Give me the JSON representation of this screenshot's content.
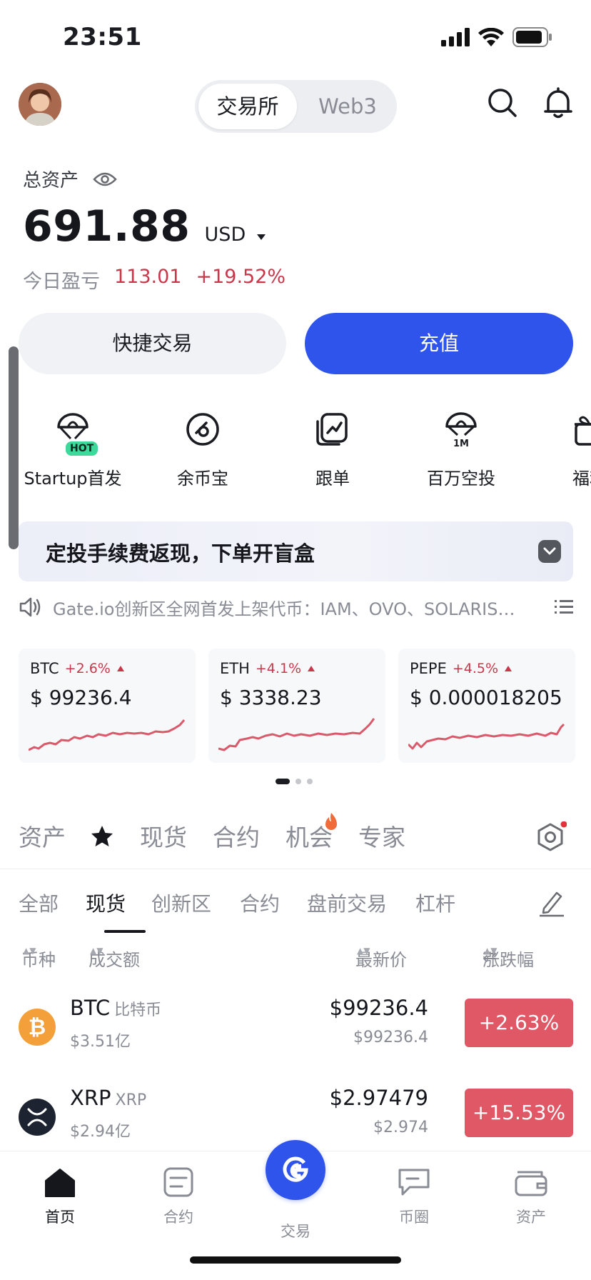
{
  "status": {
    "time": "23:51"
  },
  "top": {
    "segments": [
      "交易所",
      "Web3"
    ]
  },
  "assets": {
    "label": "总资产",
    "value": "691.88",
    "unit": "USD",
    "pnl_label": "今日盈亏",
    "pnl_value": "113.01",
    "pnl_pct": "+19.52%"
  },
  "buttons": {
    "quick": "快捷交易",
    "deposit": "充值"
  },
  "features": [
    "Startup首发",
    "余币宝",
    "跟单",
    "百万空投",
    "福利"
  ],
  "feature_badges": {
    "hot": "HOT",
    "onem": "1M"
  },
  "banner": {
    "text": "定投手续费返现，下单开盲盒"
  },
  "notice": {
    "text": "Gate.io创新区全网首发上架代币：IAM、OVO、SOLARIS…"
  },
  "tickers": [
    {
      "symbol": "BTC",
      "change": "+2.6%",
      "price": "$ 99236.4"
    },
    {
      "symbol": "ETH",
      "change": "+4.1%",
      "price": "$ 3338.23"
    },
    {
      "symbol": "PEPE",
      "change": "+4.5%",
      "price": "$ 0.000018205"
    }
  ],
  "tabs_main": [
    "资产",
    "现货",
    "合约",
    "机会",
    "专家"
  ],
  "tabs_sub": [
    "全部",
    "现货",
    "创新区",
    "合约",
    "盘前交易",
    "杠杆"
  ],
  "columns": {
    "coin": "币种",
    "volume": "成交额",
    "price": "最新价",
    "change": "涨跌幅"
  },
  "rows": [
    {
      "symbol": "BTC",
      "name": "比特币",
      "volume": "$3.51亿",
      "price": "$99236.4",
      "price_usd": "$99236.4",
      "change": "+2.63%"
    },
    {
      "symbol": "XRP",
      "name": "XRP",
      "volume": "$2.94亿",
      "price": "$2.97479",
      "price_usd": "$2.974",
      "change": "+15.53%"
    }
  ],
  "nav": [
    "首页",
    "合约",
    "交易",
    "币圈",
    "资产"
  ],
  "colors": {
    "accent": "#2f54eb",
    "down_red": "#c8384a",
    "change_badge": "#e05766"
  }
}
